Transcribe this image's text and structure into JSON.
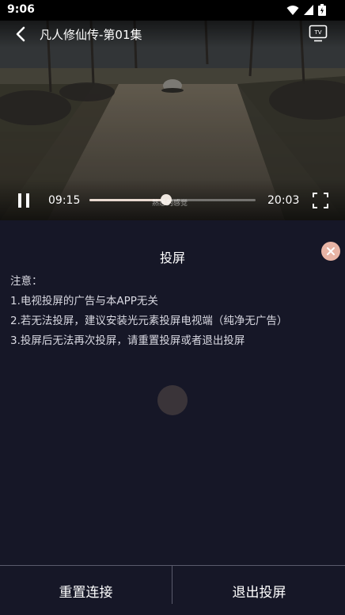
{
  "status_bar": {
    "time": "9:06"
  },
  "video": {
    "title": "凡人修仙传-第01集",
    "current_time": "09:15",
    "total_time": "20:03",
    "progress_fraction": 0.46,
    "subtitle": "熟悉的感觉"
  },
  "cast_panel": {
    "title": "投屏",
    "notes": [
      "注意：",
      "1.电视投屏的广告与本APP无关",
      "2.若无法投屏，建议安装光元素投屏电视端（纯净无广告）",
      "3.投屏后无法再次投屏，请重置投屏或者退出投屏"
    ]
  },
  "bottom_bar": {
    "reset_label": "重置连接",
    "exit_label": "退出投屏"
  },
  "colors": {
    "background": "#161727",
    "accent_close": "#e8b4a5"
  }
}
